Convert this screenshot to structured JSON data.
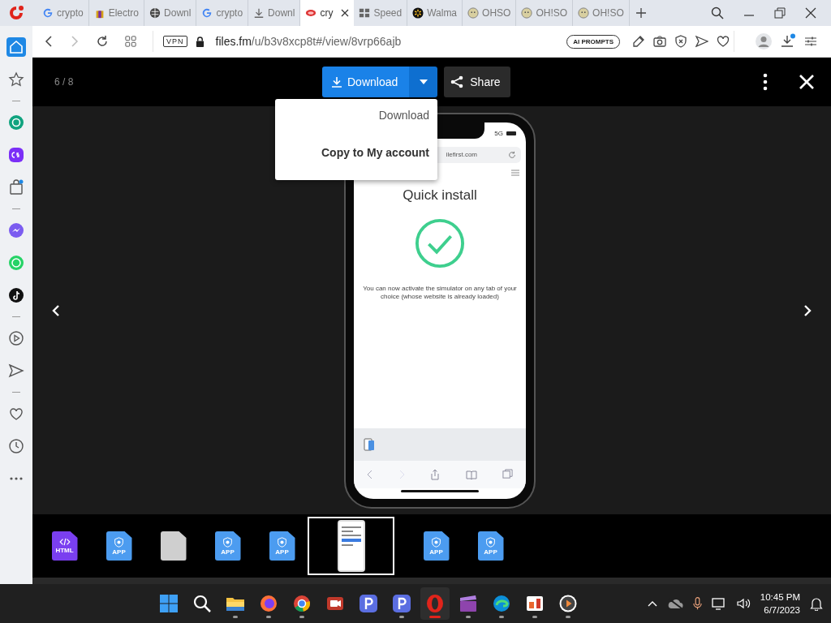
{
  "tabs": [
    {
      "label": "crypto",
      "selected": false
    },
    {
      "label": "Electro",
      "selected": false
    },
    {
      "label": "Downl",
      "selected": false
    },
    {
      "label": "crypto",
      "selected": false
    },
    {
      "label": "Downl",
      "selected": false
    },
    {
      "label": "cry",
      "selected": true
    },
    {
      "label": "Speed",
      "selected": false
    },
    {
      "label": "Walma",
      "selected": false
    },
    {
      "label": "OHSO",
      "selected": false
    },
    {
      "label": "OH!SO",
      "selected": false
    },
    {
      "label": "OH!SO",
      "selected": false
    }
  ],
  "address_bar": {
    "vpn": "VPN",
    "domain": "files.fm",
    "path": "/u/b3v8xcp8t#/view/8vrp66ajb",
    "ai_prompts": "AI PROMPTS",
    "downloads_badge": true
  },
  "sidebar": [
    {
      "selected": true
    },
    {
      "selected": false
    },
    {
      "selected": false
    },
    {
      "selected": false
    },
    {
      "selected": false
    },
    {
      "selected": false
    },
    {
      "selected": false
    },
    {
      "selected": false
    },
    {
      "selected": false
    },
    {
      "selected": false
    },
    {
      "selected": false
    },
    {
      "selected": false
    },
    {
      "selected": false
    }
  ],
  "viewer": {
    "counter": "6 / 8",
    "download_label": "Download",
    "share_label": "Share",
    "menu": [
      {
        "label": "Download",
        "bold": false
      },
      {
        "label": "Copy to My account",
        "bold": true
      }
    ],
    "phone": {
      "network": "5G",
      "url": "ilefirst.com",
      "title": "Quick install",
      "message": "You can now activate the simulator on any tab of your choice (whose website is already loaded)"
    }
  },
  "thumbnails": [
    {
      "kind": "html",
      "label": "HTML",
      "selected": false
    },
    {
      "kind": "app",
      "label": "APP",
      "selected": false
    },
    {
      "kind": "blank",
      "selected": false
    },
    {
      "kind": "app",
      "label": "APP",
      "selected": false
    },
    {
      "kind": "app",
      "label": "APP",
      "selected": false
    },
    {
      "kind": "image",
      "selected": true
    },
    {
      "kind": "app",
      "label": "APP",
      "selected": false
    },
    {
      "kind": "app",
      "label": "APP",
      "selected": false
    }
  ],
  "taskbar": {
    "apps": [
      {
        "running": false,
        "selected": false
      },
      {
        "running": false,
        "selected": false
      },
      {
        "running": true,
        "selected": false
      },
      {
        "running": true,
        "selected": false
      },
      {
        "running": true,
        "selected": false
      },
      {
        "running": false,
        "selected": false
      },
      {
        "running": false,
        "selected": false
      },
      {
        "running": true,
        "selected": false
      },
      {
        "running": true,
        "selected": true
      },
      {
        "running": true,
        "selected": false
      },
      {
        "running": true,
        "selected": false
      },
      {
        "running": true,
        "selected": false
      },
      {
        "running": true,
        "selected": false
      }
    ],
    "time": "10:45 PM",
    "date": "6/7/2023"
  }
}
